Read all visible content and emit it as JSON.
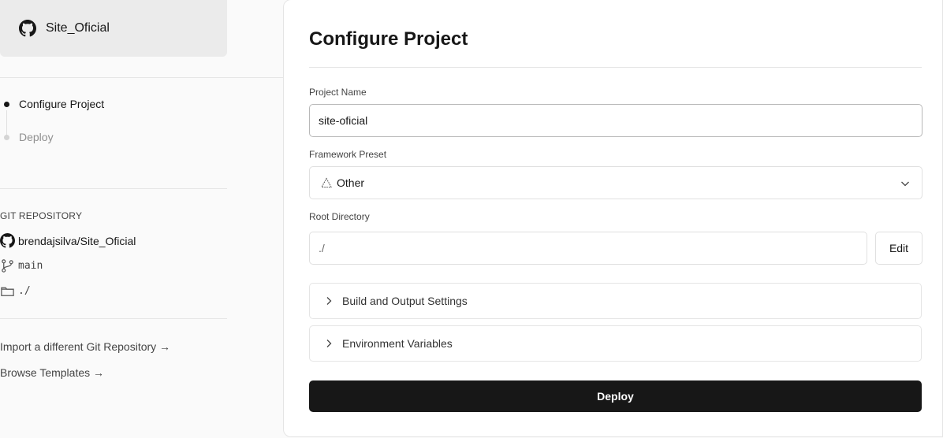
{
  "repo_card": {
    "name": "Site_Oficial",
    "icon": "github-icon"
  },
  "steps": [
    {
      "label": "Configure Project",
      "active": true
    },
    {
      "label": "Deploy",
      "active": false
    }
  ],
  "git": {
    "heading": "GIT REPOSITORY",
    "repo": "brendajsilva/Site_Oficial",
    "branch": "main",
    "directory": "./"
  },
  "links": {
    "import": "Import a different Git Repository →",
    "templates": "Browse Templates →"
  },
  "main": {
    "title": "Configure Project",
    "project_name": {
      "label": "Project Name",
      "value": "site-oficial"
    },
    "framework": {
      "label": "Framework Preset",
      "value": "Other",
      "icon": "triangle-icon"
    },
    "root": {
      "label": "Root Directory",
      "value": "./",
      "edit_label": "Edit"
    },
    "accordions": [
      {
        "label": "Build and Output Settings"
      },
      {
        "label": "Environment Variables"
      }
    ],
    "deploy_label": "Deploy"
  },
  "colors": {
    "primary": "#171717",
    "sidebar_bg": "#fafafa",
    "card_bg": "#ebebeb",
    "border": "#e5e5e5"
  }
}
